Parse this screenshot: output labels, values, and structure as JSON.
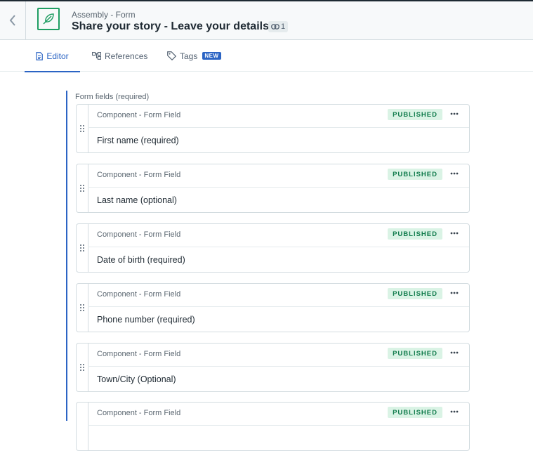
{
  "header": {
    "content_type": "Assembly - Form",
    "title": "Share your story - Leave your details",
    "reference_count": "1"
  },
  "tabs": [
    {
      "label": "Editor",
      "icon": "document-icon",
      "active": true
    },
    {
      "label": "References",
      "icon": "references-icon"
    },
    {
      "label": "Tags",
      "icon": "tag-icon",
      "badge": "NEW"
    }
  ],
  "field": {
    "label": "Form fields (required)",
    "items": [
      {
        "content_type": "Component - Form Field",
        "status": "PUBLISHED",
        "title": "First name (required)"
      },
      {
        "content_type": "Component - Form Field",
        "status": "PUBLISHED",
        "title": "Last name (optional)"
      },
      {
        "content_type": "Component - Form Field",
        "status": "PUBLISHED",
        "title": "Date of birth (required)"
      },
      {
        "content_type": "Component - Form Field",
        "status": "PUBLISHED",
        "title": "Phone number (required)"
      },
      {
        "content_type": "Component - Form Field",
        "status": "PUBLISHED",
        "title": "Town/City (Optional)"
      },
      {
        "content_type": "Component - Form Field",
        "status": "PUBLISHED",
        "title": ""
      }
    ]
  },
  "colors": {
    "accent": "#2b64c4",
    "published_bg": "#daf3e5",
    "published_text": "#0e7a4a",
    "icon_green": "#1f9e63"
  }
}
